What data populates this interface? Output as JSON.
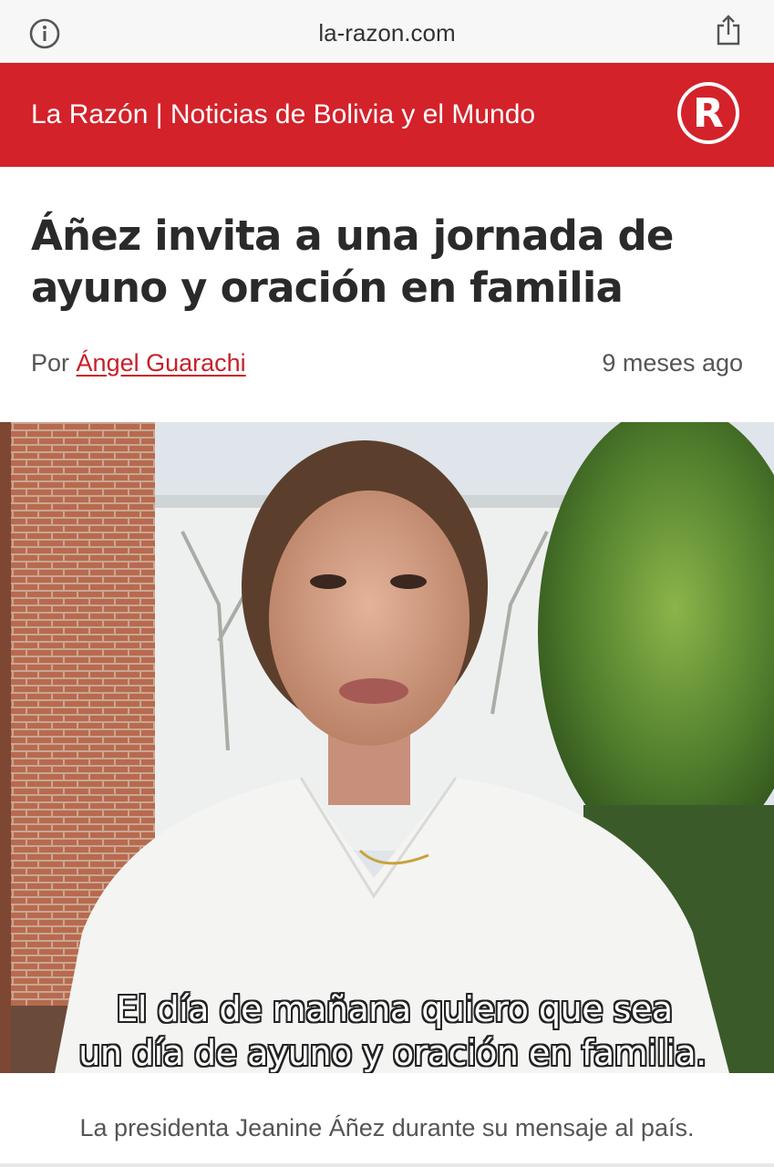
{
  "browser": {
    "url": "la-razon.com",
    "info_icon": "info-circle-icon",
    "share_icon": "share-icon"
  },
  "site": {
    "title": "La Razón | Noticias de Bolivia y el Mundo",
    "logo_letter": "R",
    "brand_color": "#d3222a"
  },
  "article": {
    "headline": "Áñez invita a una jornada de ayuno y oración en familia",
    "byline_prefix": "Por",
    "author": "Ángel Guarachi",
    "timestamp": "9 meses ago",
    "image": {
      "subtitle_line1": "El día de mañana quiero que sea",
      "subtitle_line2": "un día de ayuno y oración en familia."
    },
    "caption": "La presidenta Jeanine Áñez durante su mensaje al país."
  }
}
